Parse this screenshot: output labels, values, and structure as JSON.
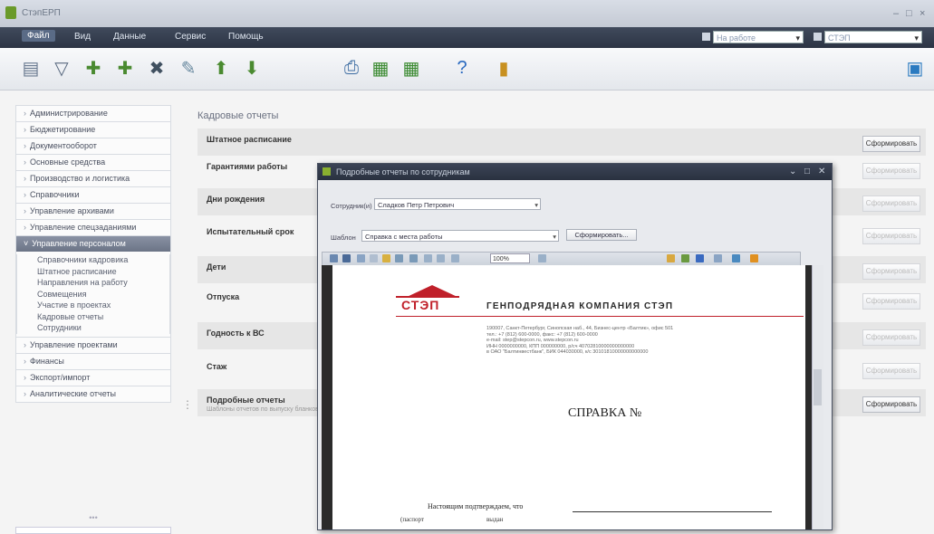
{
  "window": {
    "title": "СтэпЕРП"
  },
  "menu": {
    "items": [
      "Файл",
      "Вид",
      "Данные",
      "Сервис",
      "Помощь"
    ],
    "status_value": "На работе",
    "company_value": "СТЭП"
  },
  "toolbar": {
    "icons": [
      "report-icon",
      "filter-icon",
      "add-icon",
      "add-copy-icon",
      "delete-icon",
      "edit-icon",
      "move-up-icon",
      "move-down-icon",
      "print-icon",
      "export-excel-icon",
      "import-excel-icon",
      "help-icon",
      "exit-icon",
      "calendar-icon"
    ]
  },
  "sidebar": {
    "items": [
      "Администрирование",
      "Бюджетирование",
      "Документооборот",
      "Основные средства",
      "Производство и логистика",
      "Справочники",
      "Управление архивами",
      "Управление спецзаданиями"
    ],
    "active_item": "Управление персоналом",
    "sub_items": [
      "Справочники кадровика",
      "Штатное расписание",
      "Направления на работу",
      "Совмещения",
      "Участие в проектах",
      "Кадровые отчеты",
      "Сотрудники"
    ],
    "items_after": [
      "Управление проектами",
      "Финансы",
      "Экспорт/импорт",
      "Аналитические отчеты"
    ],
    "bottom_marker": "•••"
  },
  "main": {
    "title": "Кадровые отчеты",
    "save_label": "Сформировать",
    "reports": [
      {
        "name": "Штатное расписание",
        "sub": "",
        "shaded": true,
        "enabled": true
      },
      {
        "name": "Гарантиями работы",
        "sub": "",
        "shaded": false,
        "enabled": false
      },
      {
        "name": "Дни рождения",
        "sub": "",
        "shaded": true,
        "enabled": false
      },
      {
        "name": "Испытательный срок",
        "sub": "",
        "shaded": false,
        "enabled": false
      },
      {
        "name": "Дети",
        "sub": "",
        "shaded": true,
        "enabled": false
      },
      {
        "name": "Отпуска",
        "sub": "",
        "shaded": false,
        "enabled": false
      },
      {
        "name": "Годность к ВС",
        "sub": "",
        "shaded": true,
        "enabled": false
      },
      {
        "name": "Стаж",
        "sub": "",
        "shaded": false,
        "enabled": false
      },
      {
        "name": "Подробные отчеты",
        "sub": "Шаблоны отчетов по выпуску бланков",
        "shaded": true,
        "enabled": true
      }
    ]
  },
  "dialog": {
    "title": "Подробные отчеты по сотрудникам",
    "employee_label": "Сотрудник(и)",
    "employee_value": "Сладков Петр Петрович",
    "template_label": "Шаблон",
    "template_value": "Справка с места работы",
    "form_button": "Сформировать...",
    "zoom_value": "100%",
    "document": {
      "logo": "СТЭП",
      "company": "ГЕНПОДРЯДНАЯ КОМПАНИЯ СТЭП",
      "address_lines": [
        "190007, Санкт-Петербург, Синопская наб., 44, Бизнес-центр «Балтик», офис 501",
        "тел.: +7 (812) 600-0000, факс: +7 (812) 600-0000",
        "e-mail: step@stepcon.ru, www.stepcon.ru",
        "ИНН 0000000000, КПП 000000000, р/сч 40702810000000000000",
        "в ОАО \"Балтинвестбанк\", БИК 044030000, к/с 30101810000000000000"
      ],
      "title": "СПРАВКА №",
      "body_line": "Настоящим подтверждаем, что",
      "footer_left": "(паспорт",
      "footer_right": "выдан"
    }
  }
}
